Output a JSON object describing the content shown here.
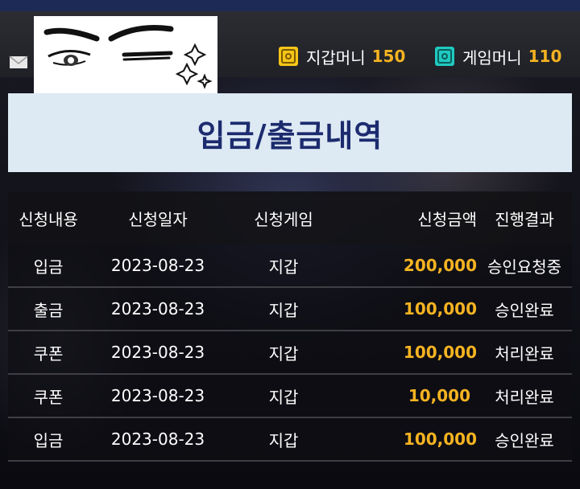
{
  "header": {
    "wallet_label": "지갑머니",
    "wallet_amount": "150",
    "game_label": "게임머니",
    "game_amount": "110"
  },
  "title": "입금/출금내역",
  "table": {
    "columns": [
      "신청내용",
      "신청일자",
      "신청게임",
      "신청금액",
      "진행결과"
    ],
    "rows": [
      [
        "입금",
        "2023-08-23",
        "지갑",
        "200,000",
        "승인요청중"
      ],
      [
        "출금",
        "2023-08-23",
        "지갑",
        "100,000",
        "승인완료"
      ],
      [
        "쿠폰",
        "2023-08-23",
        "지갑",
        "100,000",
        "처리완료"
      ],
      [
        "쿠폰",
        "2023-08-23",
        "지갑",
        "10,000",
        "처리완료"
      ],
      [
        "입금",
        "2023-08-23",
        "지갑",
        "100,000",
        "승인완료"
      ]
    ]
  },
  "colors": {
    "accent": "#f5b321",
    "title_text": "#1c2b6e",
    "wallet_icon": "#f5c518",
    "game_icon": "#1fc9c0"
  },
  "icons": {
    "mail": "mail-icon",
    "wallet": "safe-icon",
    "game": "safe-icon"
  }
}
